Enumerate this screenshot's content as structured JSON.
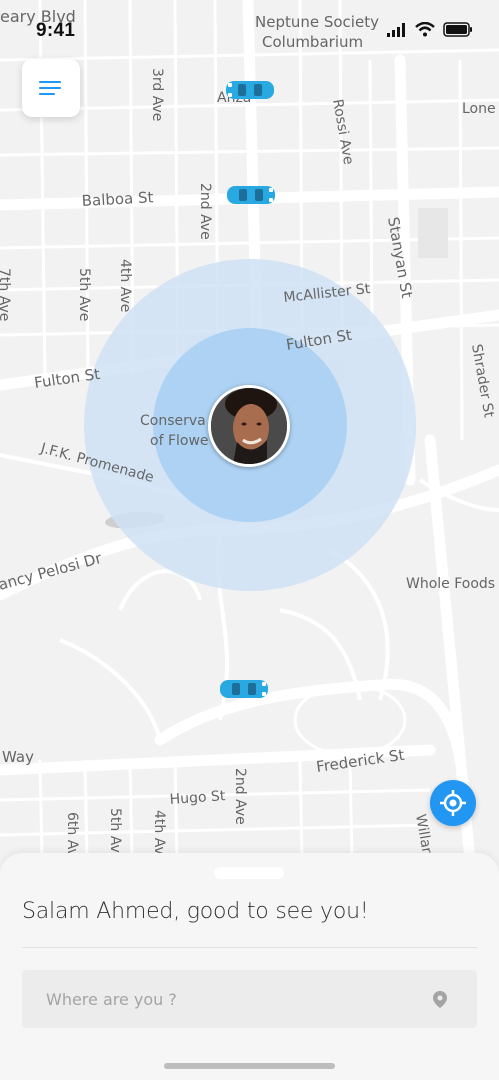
{
  "status_bar": {
    "time": "9:41"
  },
  "map": {
    "labels": {
      "geary_blvd": "eary Blvd",
      "neptune_1": "Neptune Society",
      "neptune_2": "Columbarium",
      "lone": "Lone",
      "ave_3rd_top": "3rd Ave",
      "anza": "Anza",
      "rossi": "Rossi Ave",
      "balboa": "Balboa St",
      "ave_2nd_top": "2nd Ave",
      "stanyan": "Stanyan St",
      "ave_7th_left": "7th Ave",
      "ave_5th": "5th Ave",
      "ave_4th": "4th Ave",
      "mcallister": "McAllister St",
      "fulton_right": "Fulton St",
      "fulton_left": "Fulton St",
      "shrader": "Shrader St",
      "conserv_1": "Conserva",
      "conserv_2": "of Flowe",
      "jfk": "J.F.K. Promenade",
      "pelosi": "ancy Pelosi Dr",
      "whole_foods": "Whole Foods",
      "way": "Way",
      "frederick": "Frederick St",
      "hugo": "Hugo St",
      "ave_2nd_bottom": "2nd Ave",
      "ave_6th_bottom": "6th Ave",
      "ave_5th_bottom": "5th Ave",
      "ave_4th_bottom": "4th Ave",
      "willard": "Willar"
    }
  },
  "menu": {
    "icon": "menu-icon"
  },
  "locate": {
    "icon": "crosshair-icon"
  },
  "sheet": {
    "greeting": "Salam Ahmed, good to see you!",
    "search_placeholder": "Where are you ?",
    "search_icon": "location-pin-icon"
  },
  "colors": {
    "accent": "#2196f3",
    "radius_outer": "#cfe2f6",
    "radius_inner": "#a9cff3",
    "car": "#29a9e1"
  }
}
